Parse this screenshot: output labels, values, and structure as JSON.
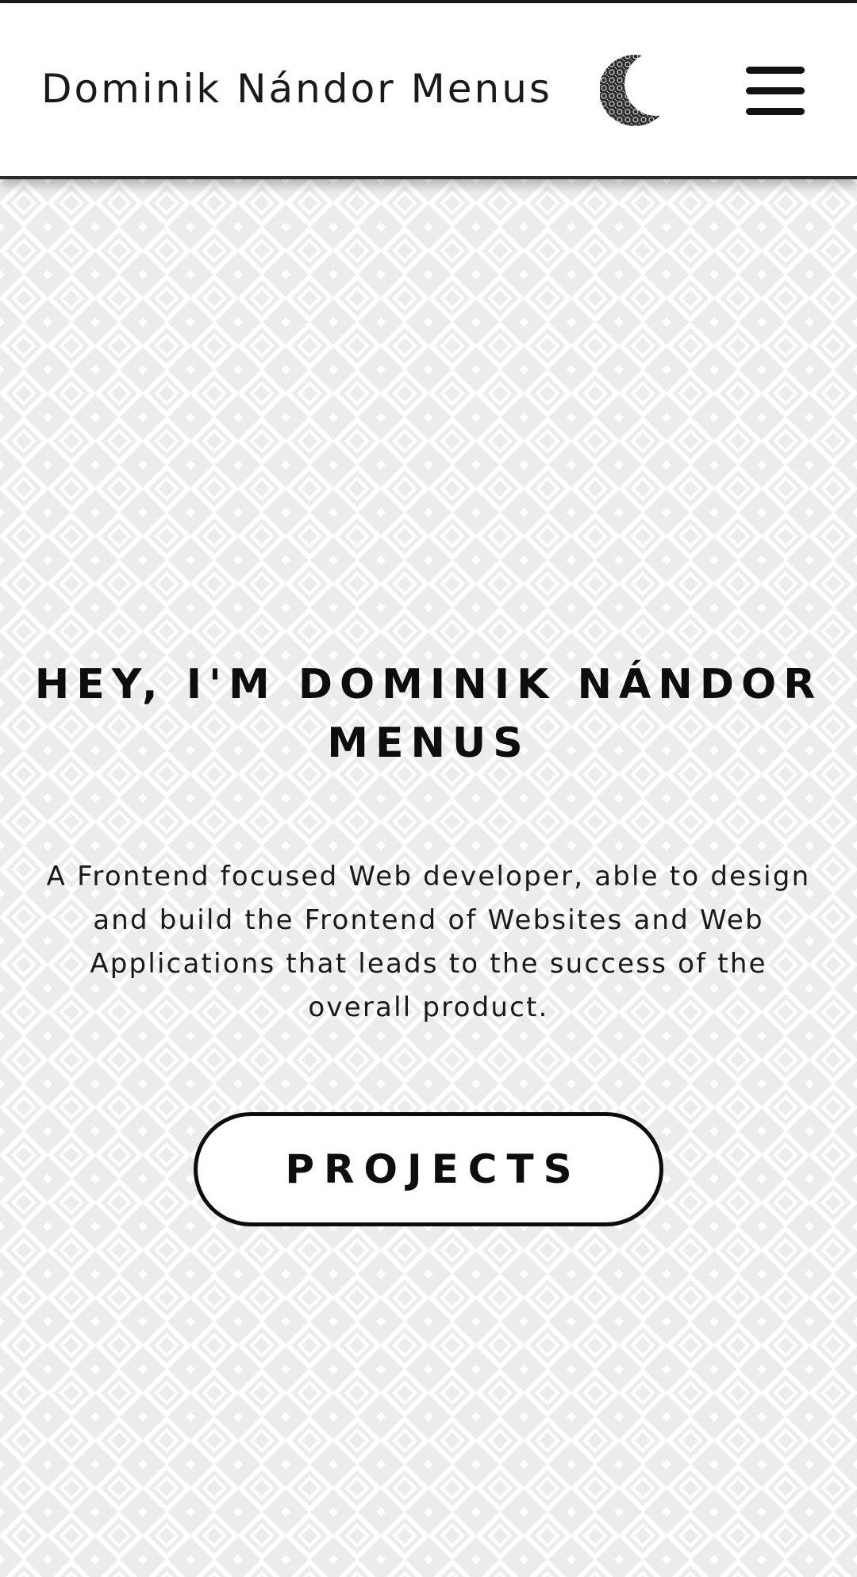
{
  "header": {
    "site_title": "Dominik Nándor Menus",
    "theme_toggle_icon": "crescent-moon-icon",
    "menu_icon": "hamburger-menu-icon"
  },
  "hero": {
    "heading": "HEY, I'M DOMINIK NÁNDOR MENUS",
    "description": "A Frontend focused Web developer, able to design and build the Frontend of Websites and Web Applications that leads to the success of the overall product.",
    "projects_button_label": "PROJECTS"
  },
  "colors": {
    "text": "#111111",
    "background": "#ffffff",
    "pattern_base": "#ececec",
    "pattern_lines": "#ffffff"
  }
}
